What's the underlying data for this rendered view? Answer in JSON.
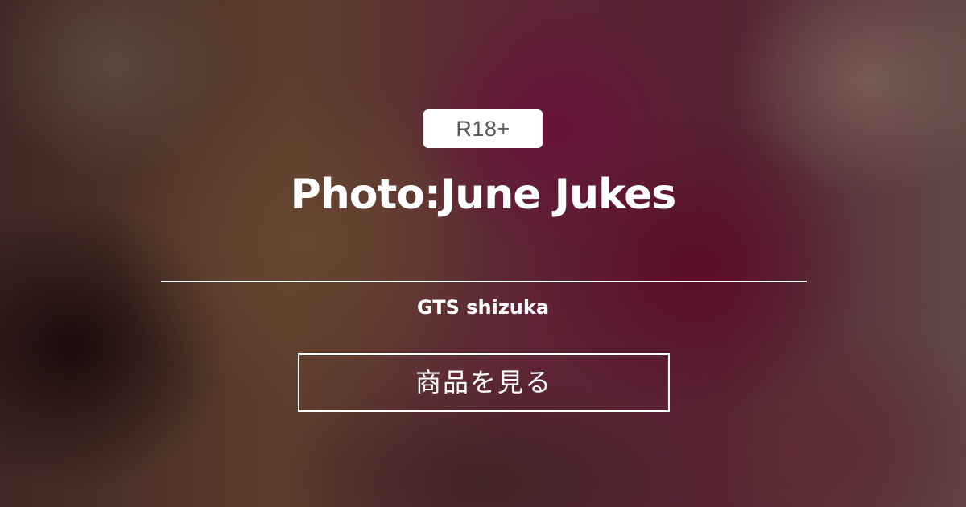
{
  "badge": {
    "label": "R18+"
  },
  "title": "Photo:June Jukes",
  "author": "GTS shizuka",
  "cta": {
    "label": "商品を見る"
  }
}
